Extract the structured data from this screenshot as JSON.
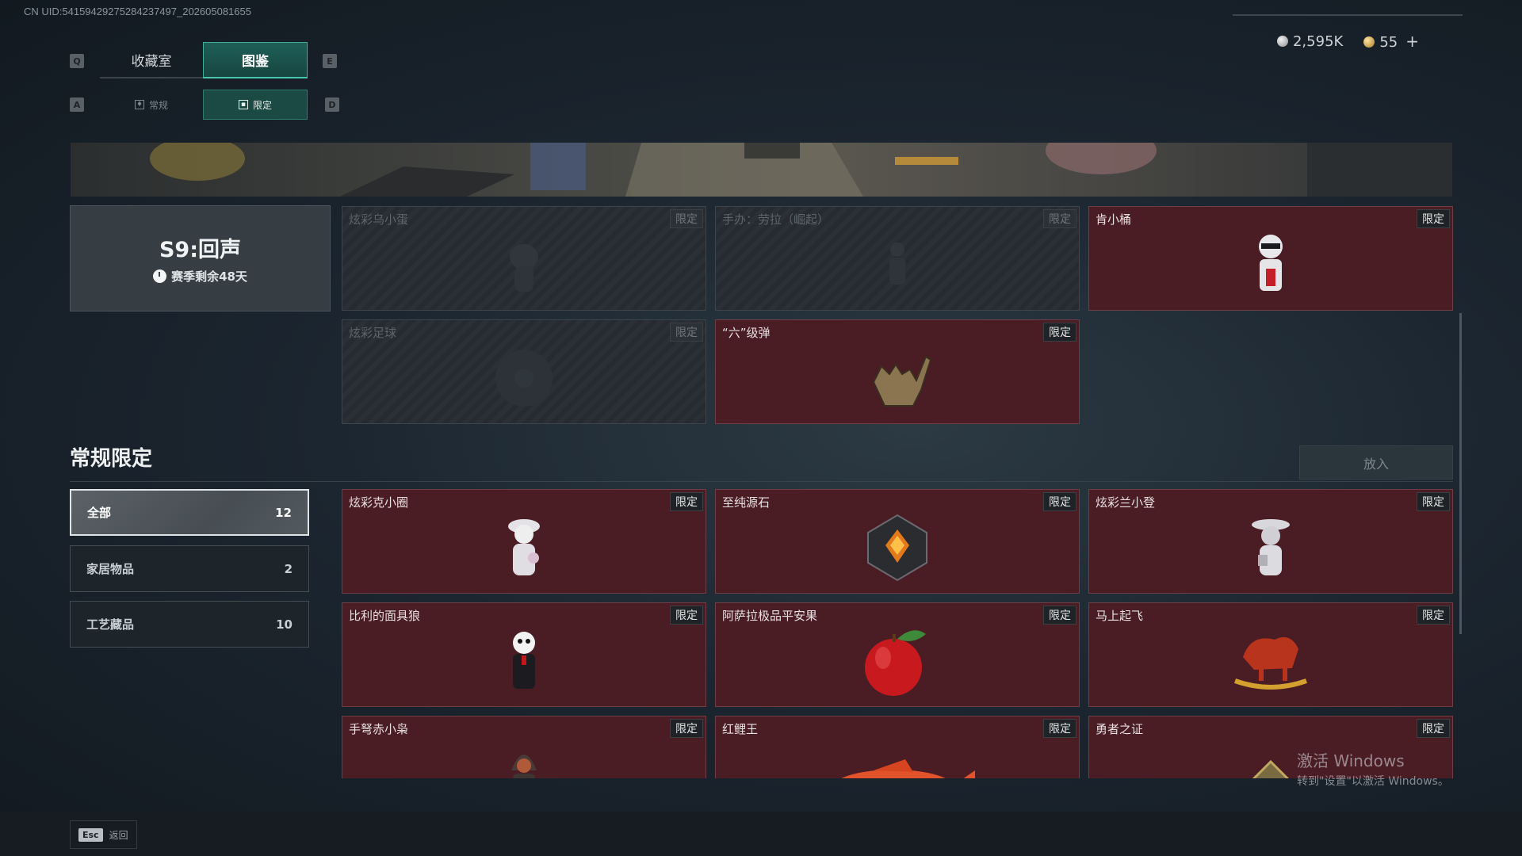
{
  "uid": "CN UID:541594292752842374​97_202605081655",
  "keys": {
    "left_tab": "Q",
    "right_tab": "E",
    "left_sub": "A",
    "right_sub": "D"
  },
  "tabs": [
    "收藏室",
    "图鉴"
  ],
  "active_tab": "图鉴",
  "subtabs": [
    "常规",
    "限定"
  ],
  "active_subtab": "限定",
  "currency": {
    "silver": "2,595K",
    "gold": "55",
    "plus": "+"
  },
  "season": {
    "title": "S9:回声",
    "remaining": "赛季剩余48天"
  },
  "season_items": [
    {
      "name": "炫彩乌小蛋",
      "badge": "限定",
      "locked": true,
      "icon": "egg-figure-icon"
    },
    {
      "name": "手办：劳拉（崛起）",
      "badge": "限定",
      "locked": true,
      "icon": "figure-icon"
    },
    {
      "name": "肯小桶",
      "badge": "限定",
      "locked": false,
      "icon": "colonel-figure-icon"
    },
    {
      "name": "炫彩足球",
      "badge": "限定",
      "locked": true,
      "icon": "football-icon"
    },
    {
      "name": "“六”级弹",
      "badge": "限定",
      "locked": false,
      "icon": "hand-sign-icon"
    }
  ],
  "section": {
    "title": "常规限定",
    "put_button": "放入"
  },
  "filters": [
    {
      "label": "全部",
      "count": "12",
      "active": true
    },
    {
      "label": "家居物品",
      "count": "2",
      "active": false
    },
    {
      "label": "工艺藏品",
      "count": "10",
      "active": false
    }
  ],
  "items": [
    {
      "name": "炫彩克小圈",
      "badge": "限定",
      "icon": "girl-figure-icon"
    },
    {
      "name": "至纯源石",
      "badge": "限定",
      "icon": "crystal-icon"
    },
    {
      "name": "炫彩兰小登",
      "badge": "限定",
      "icon": "sombrero-figure-icon"
    },
    {
      "name": "比利的面具狼",
      "badge": "限定",
      "icon": "puppet-icon"
    },
    {
      "name": "阿萨拉极品平安果",
      "badge": "限定",
      "icon": "apple-icon"
    },
    {
      "name": "马上起飞",
      "badge": "限定",
      "icon": "rocking-horse-icon"
    },
    {
      "name": "手弩赤小枭",
      "badge": "限定",
      "icon": "hooded-figure-icon"
    },
    {
      "name": "红鲤王",
      "badge": "限定",
      "icon": "carp-icon"
    },
    {
      "name": "勇者之证",
      "badge": "限定",
      "icon": "medal-icon"
    }
  ],
  "watermark": {
    "line1": "激活 Windows",
    "line2": "转到\"设置\"以激活 Windows。"
  },
  "footer": {
    "key": "Esc",
    "label": "返回"
  },
  "colors": {
    "accent": "#49c6ad",
    "card_bg": "#4a1c24",
    "card_border": "#6e3d45"
  }
}
